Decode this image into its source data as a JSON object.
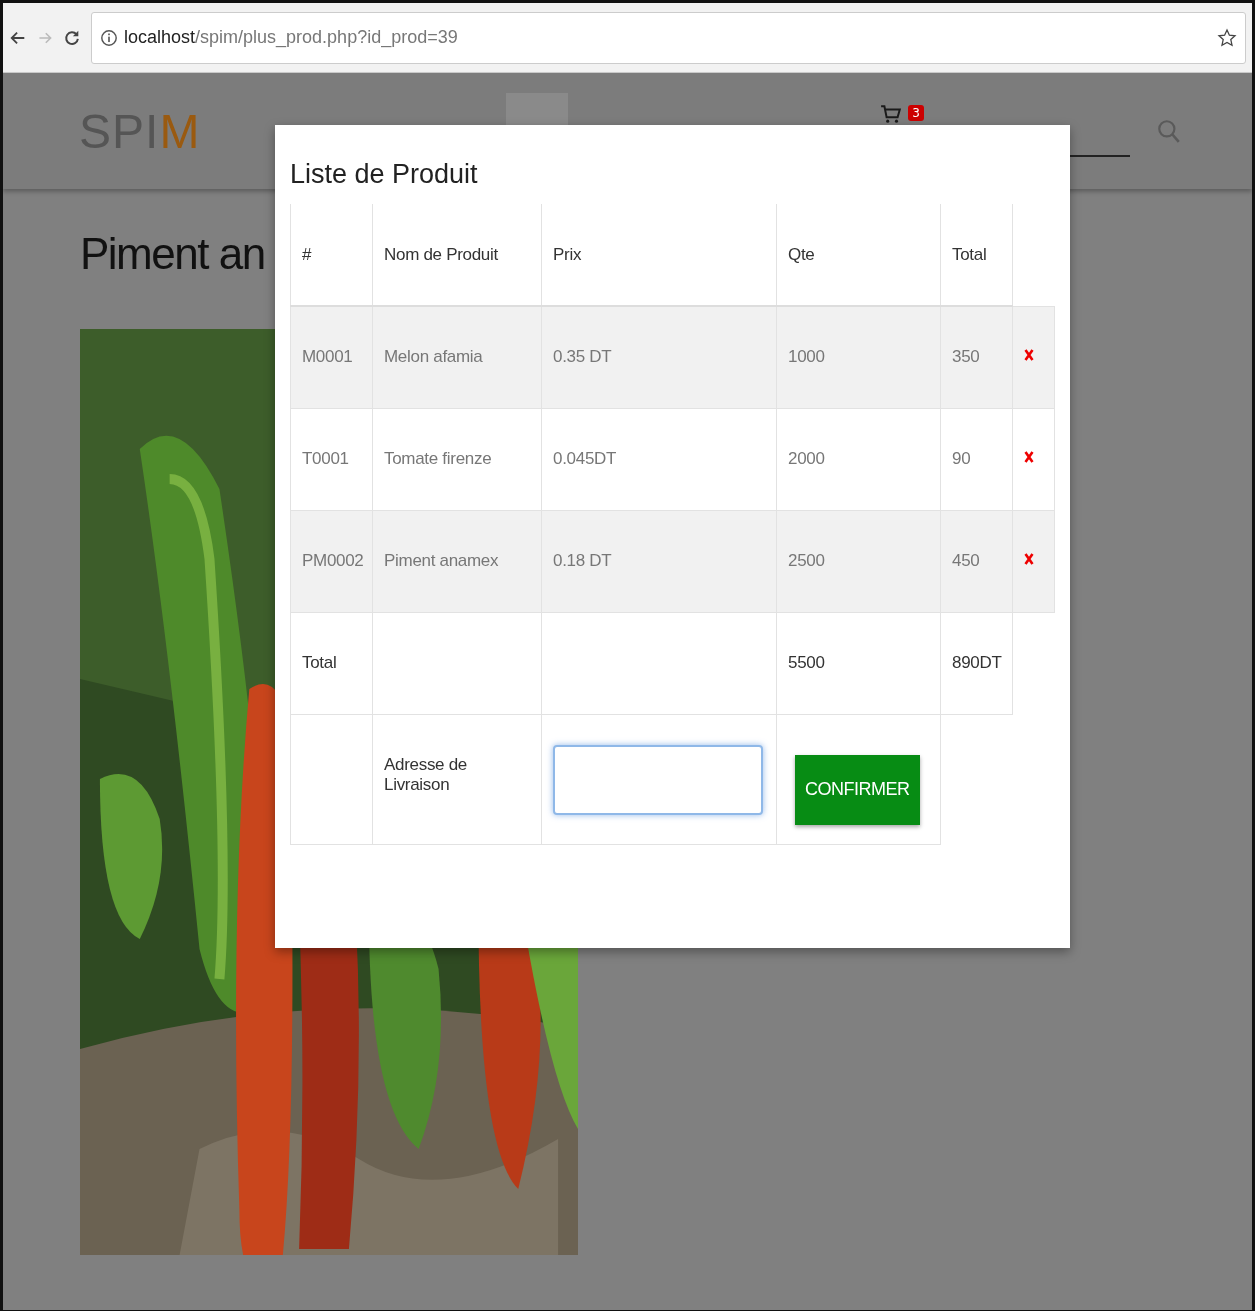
{
  "browser": {
    "url_host": "localhost",
    "url_path": "/spim/plus_prod.php?id_prod=39",
    "forward_disabled": true
  },
  "header": {
    "logo_start": "SPI",
    "logo_end": "M",
    "cart_count": "3"
  },
  "page": {
    "title": "Piment an"
  },
  "modal": {
    "title": "Liste de Produit",
    "columns": [
      "#",
      "Nom de Produit",
      "Prix",
      "Qte",
      "Total"
    ],
    "rows": [
      {
        "code": "M0001",
        "name": "Melon afamia",
        "price": "0.35 DT",
        "qty": "1000",
        "total": "350"
      },
      {
        "code": "T0001",
        "name": "Tomate firenze",
        "price": "0.045DT",
        "qty": "2000",
        "total": "90"
      },
      {
        "code": "PM0002",
        "name": "Piment anamex",
        "price": "0.18 DT",
        "qty": "2500",
        "total": "450"
      }
    ],
    "totals": {
      "label": "Total",
      "qty": "5500",
      "total": "890DT"
    },
    "address": {
      "label": "Adresse de Livraison",
      "focused": true
    },
    "confirm_button": "CONFIRMER"
  }
}
